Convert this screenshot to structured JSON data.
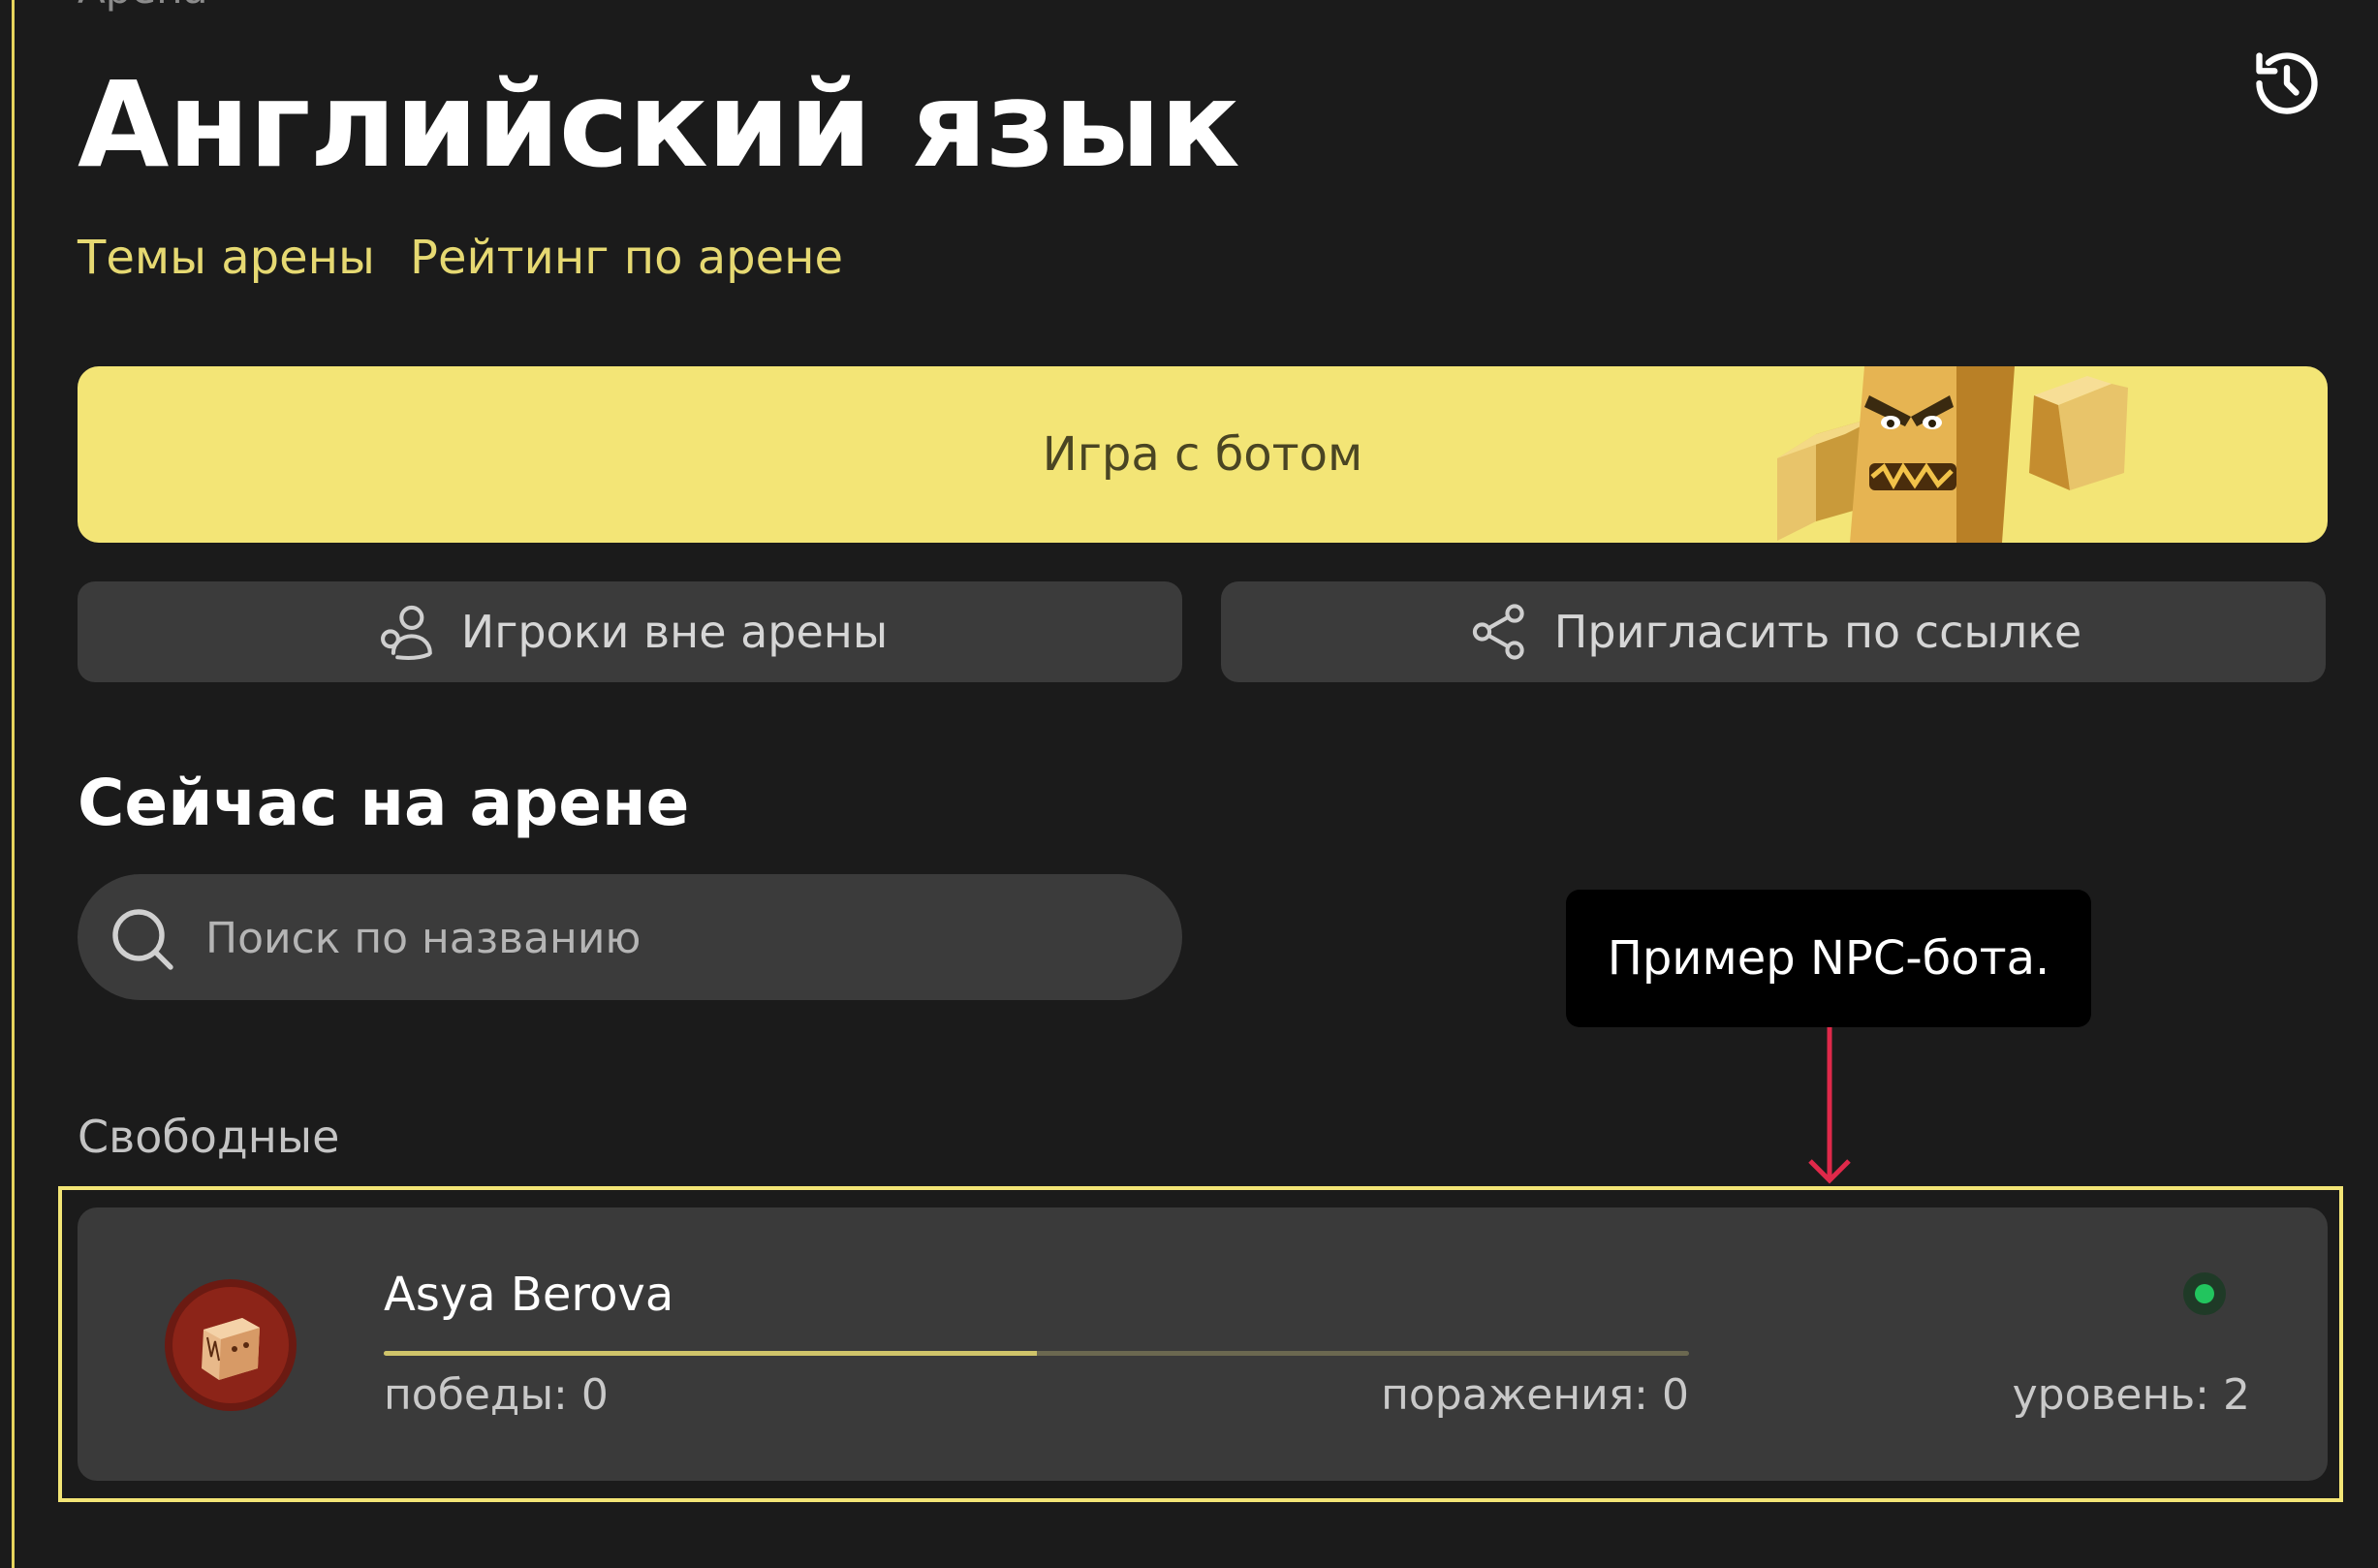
{
  "breadcrumb": "Арена",
  "page": {
    "title": "Английский язык"
  },
  "tabs": [
    {
      "label": "Темы арены"
    },
    {
      "label": "Рейтинг по арене"
    }
  ],
  "bot_game": {
    "label": "Игра с ботом"
  },
  "actions": {
    "players_outside": {
      "label": "Игроки вне арены",
      "icon": "users-icon"
    },
    "invite_link": {
      "label": "Пригласить по ссылке",
      "icon": "share-icon"
    }
  },
  "section": {
    "title": "Сейчас на арене"
  },
  "search": {
    "placeholder": "Поиск по названию",
    "value": ""
  },
  "tooltip": {
    "text": "Пример NPC-бота."
  },
  "free_label": "Свободные",
  "players": [
    {
      "name": "Asya Berova",
      "wins": "победы: 0",
      "losses": "поражения: 0",
      "level": "уровень: 2",
      "progress": 0.5,
      "online": true
    }
  ],
  "colors": {
    "background": "#1b1b1b",
    "accent": "#f3e576",
    "tab_text": "#e6d972",
    "button_dark": "#3b3b3b",
    "online": "#22c55e",
    "arrow": "#e0294a"
  }
}
